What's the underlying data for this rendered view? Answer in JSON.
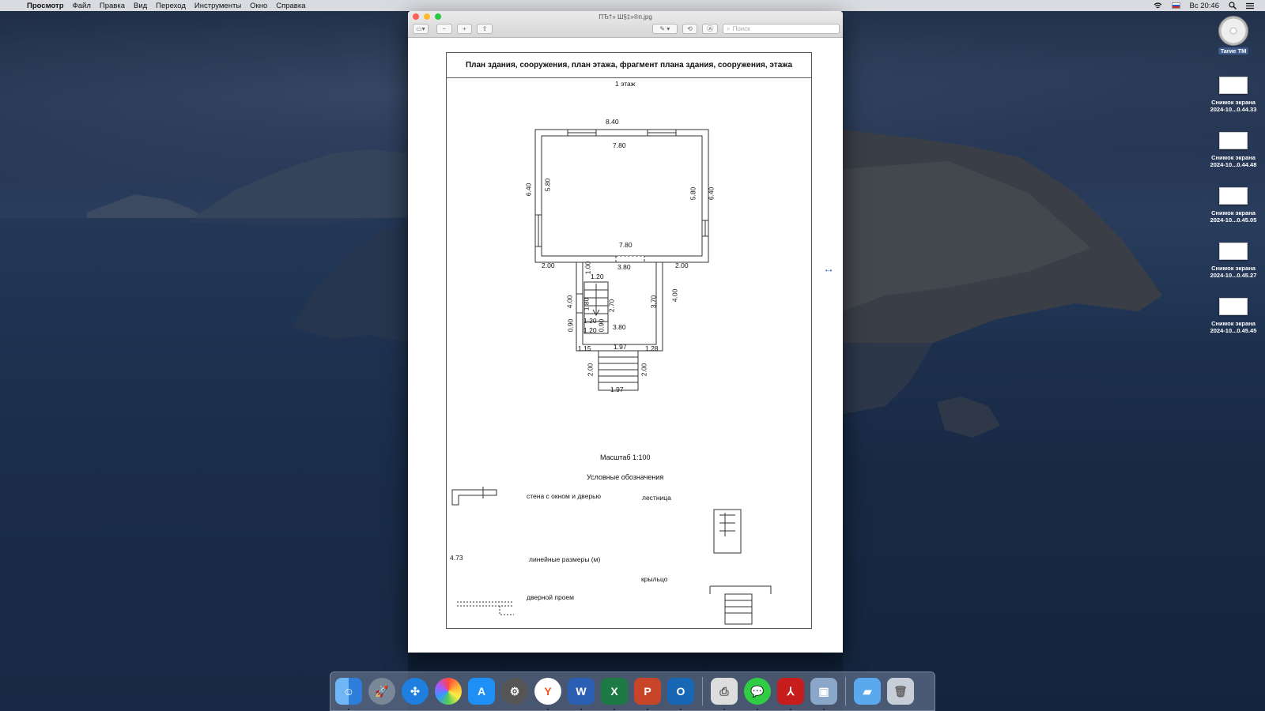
{
  "menubar": {
    "app_name": "Просмотр",
    "items": [
      "Файл",
      "Правка",
      "Вид",
      "Переход",
      "Инструменты",
      "Окно",
      "Справка"
    ],
    "clock": "Вс 20:46"
  },
  "window": {
    "title": "ПЂ†» Ш§‡»®п.jpg",
    "search_placeholder": "Поиск"
  },
  "document": {
    "title": "План здания, сооружения, план этажа, фрагмент плана здания, сооружения, этажа",
    "floor_label": "1  этаж",
    "dimensions": {
      "top_outer": "8.40",
      "top_inner": "7.80",
      "left_outer": "6.40",
      "left_inner": "5.80",
      "right_inner": "5.80",
      "right_outer": "6.40",
      "bottom_inner": "7.80",
      "left_ledge": "2.00",
      "right_ledge": "2.00",
      "corridor_width": "3.80",
      "wing_left": "4.00",
      "wing_right": "4.00",
      "wing_inner": "3.70",
      "stair_top": "1.00",
      "stair_width": "1.20",
      "stair_run": "1.80",
      "stair_len": "2.70",
      "stair_gap": "0.90",
      "stair_gap2": "0.90",
      "stair_w2": "1.20",
      "stair_w3": "1.20",
      "wing_bottom": "3.80",
      "porch_left": "1.15",
      "porch_top": "1.97",
      "porch_right": "1.28",
      "porch_h_left": "2.00",
      "porch_h_right": "2.00",
      "porch_bottom": "1.97"
    },
    "scale": "Масштаб 1:100",
    "legend_title": "Условные обозначения",
    "legend": {
      "wall": "стена с окном и дверью",
      "stairs": "лестница",
      "dims_sample": "4.73",
      "dims": "линейные   размеры (м)",
      "porch": "крыльцо",
      "doorway": "дверной  проем"
    }
  },
  "desktop_icons": [
    {
      "line1": "Tarие TM",
      "line2": ""
    },
    {
      "line1": "Снимок экрана",
      "line2": "2024-10...0.44.33"
    },
    {
      "line1": "Снимок экрана",
      "line2": "2024-10...0.44.48"
    },
    {
      "line1": "Снимок экрана",
      "line2": "2024-10...0.45.05"
    },
    {
      "line1": "Снимок экрана",
      "line2": "2024-10...0.45.27"
    },
    {
      "line1": "Снимок экрана",
      "line2": "2024-10...0.45.45"
    }
  ],
  "dock": [
    "finder-icon",
    "launchpad-icon",
    "safari-icon",
    "photos-icon",
    "app-store-icon",
    "system-preferences-icon",
    "yandex-browser-icon",
    "word-icon",
    "excel-icon",
    "powerpoint-icon",
    "outlook-icon",
    "printer-icon",
    "messages-icon",
    "acrobat-icon",
    "preview-icon",
    "folder-icon",
    "trash-icon"
  ]
}
